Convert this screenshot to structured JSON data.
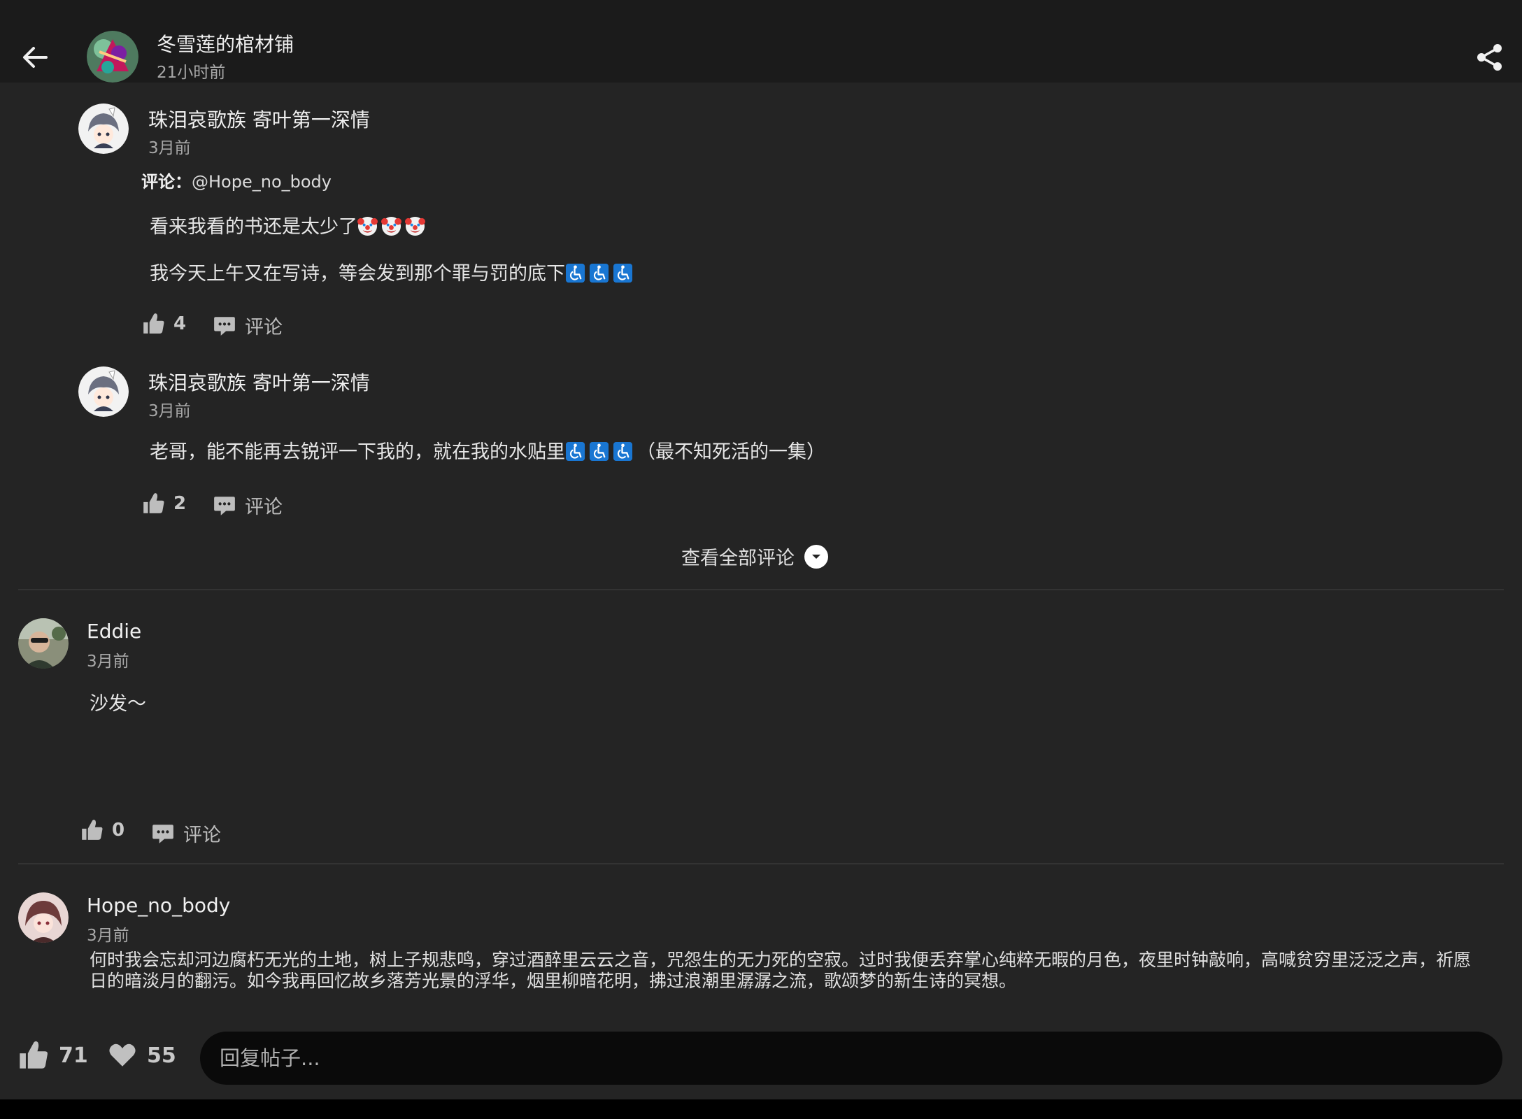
{
  "header": {
    "post_title": "冬雪莲的棺材铺",
    "post_time": "21小时前"
  },
  "comments": [
    {
      "user": "珠泪哀歌族 寄叶第一深情",
      "time": "3月前",
      "reply_label": "评论：",
      "reply_to": "@Hope_no_body",
      "line1": "看来我看的书还是太少了",
      "line2": "我今天上午又在写诗，等会发到那个罪与罚的底下",
      "likes": "4",
      "comment_label": "评论"
    },
    {
      "user": "珠泪哀歌族 寄叶第一深情",
      "time": "3月前",
      "line1_a": "老哥，能不能再去锐评一下我的，就在我的水贴里",
      "line1_b": "（最不知死活的一集）",
      "likes": "2",
      "comment_label": "评论"
    }
  ],
  "view_all_label": "查看全部评论",
  "eddie": {
    "user": "Eddie",
    "time": "3月前",
    "text": "沙发～",
    "likes": "0",
    "comment_label": "评论"
  },
  "op": {
    "user": "Hope_no_body",
    "time": "3月前",
    "text": "何时我会忘却河边腐朽无光的土地，树上子规悲鸣，穿过酒醉里云云之音，咒怨生的无力死的空寂。过时我便丢弃掌心纯粹无暇的月色，夜里时钟敲响，高喊贫穷里泛泛之声，祈愿日的暗淡月的翻污。如今我再回忆故乡落芳光景的浮华，烟里柳暗花明，拂过浪潮里潺潺之流，歌颂梦的新生诗的冥想。"
  },
  "footer": {
    "likes": "71",
    "favorites": "55",
    "reply_placeholder": "回复帖子..."
  }
}
